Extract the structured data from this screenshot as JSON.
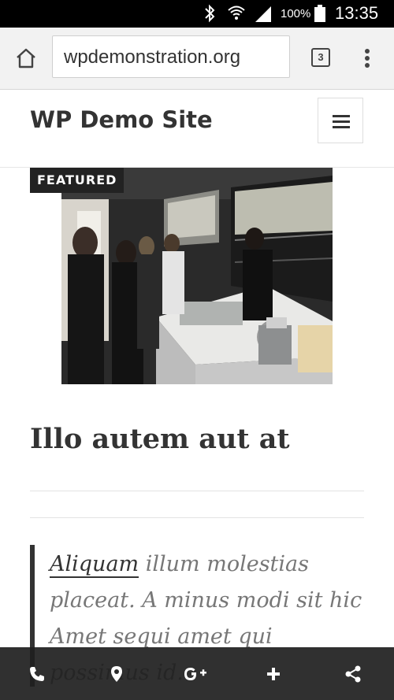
{
  "status_bar": {
    "battery_percent": "100%",
    "time": "13:35",
    "icons": [
      "bluetooth-icon",
      "wifi-icon",
      "signal-icon",
      "battery-icon"
    ]
  },
  "browser": {
    "url": "wpdemonstration.org",
    "tab_count": "3"
  },
  "site": {
    "title": "WP Demo Site"
  },
  "post": {
    "badge": "FEATURED",
    "title": "Illo autem aut at",
    "quote_link": "Aliquam",
    "quote_rest": " illum molestias placeat. A minus modi sit hic Amet sequi amet qui possimus id."
  },
  "bottom_bar": {
    "icons": [
      "phone-icon",
      "location-pin-icon",
      "google-plus-icon",
      "plus-icon",
      "share-icon"
    ]
  },
  "colors": {
    "status_bar": "#000000",
    "browser_bar": "#f2f2f2",
    "text_dark": "#333333",
    "quote_text": "#777777",
    "bottom_bar": "#1e1e1e"
  }
}
